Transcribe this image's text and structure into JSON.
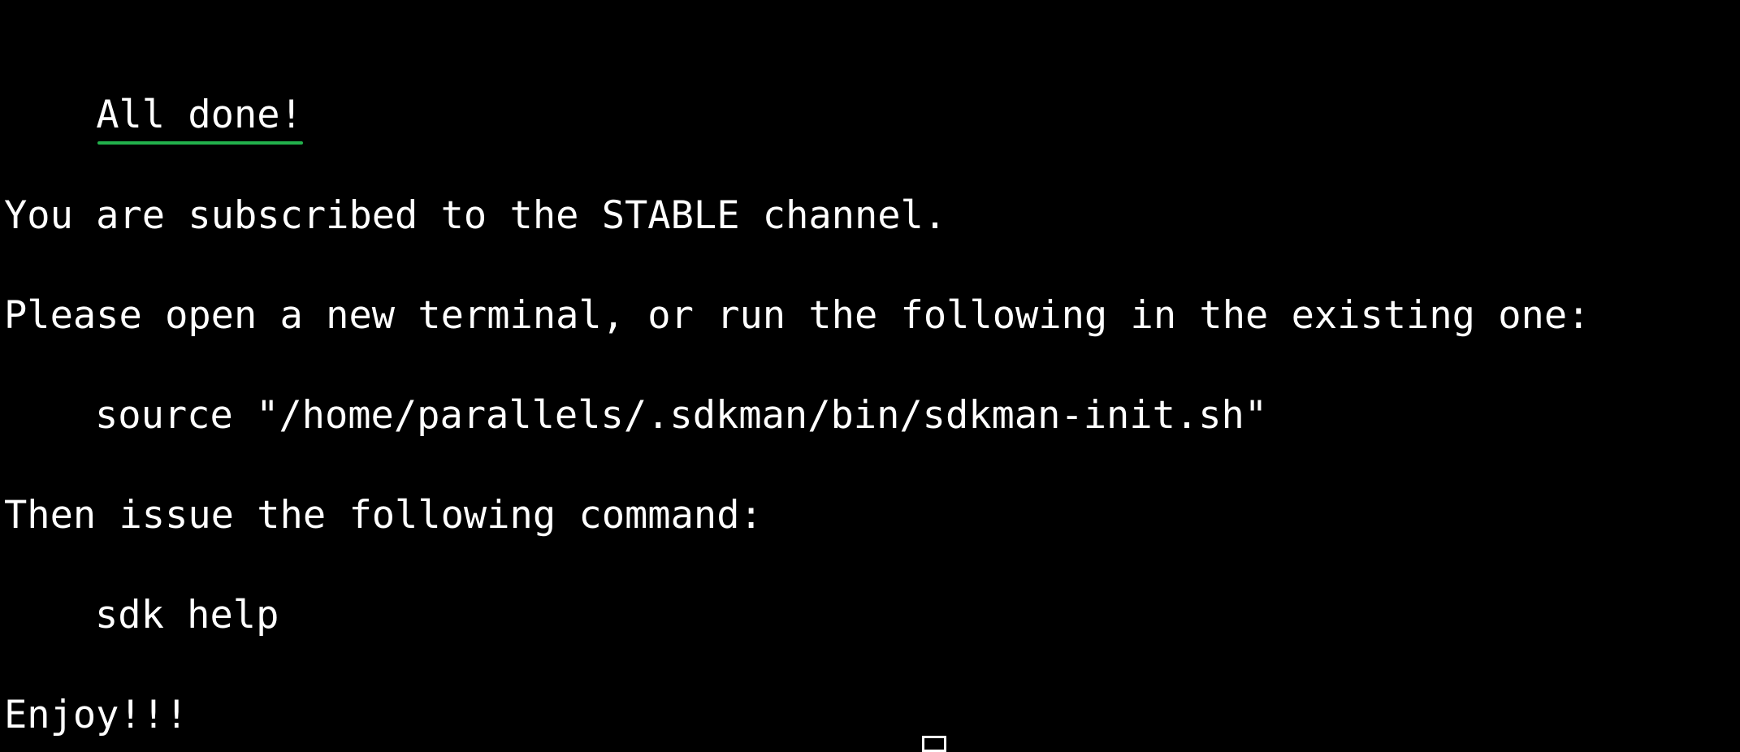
{
  "terminal": {
    "lines": {
      "all_done": "All done!",
      "subscribed": "You are subscribed to the STABLE channel.",
      "open_terminal": "Please open a new terminal, or run the following in the existing one:",
      "source_cmd": "source \"/home/parallels/.sdkman/bin/sdkman-init.sh\"",
      "issue_cmd": "Then issue the following command:",
      "sdk_help": "sdk help",
      "enjoy": "Enjoy!!!"
    },
    "colors": {
      "background": "#000000",
      "text": "#ffffff",
      "underline": "#22b14c"
    }
  }
}
